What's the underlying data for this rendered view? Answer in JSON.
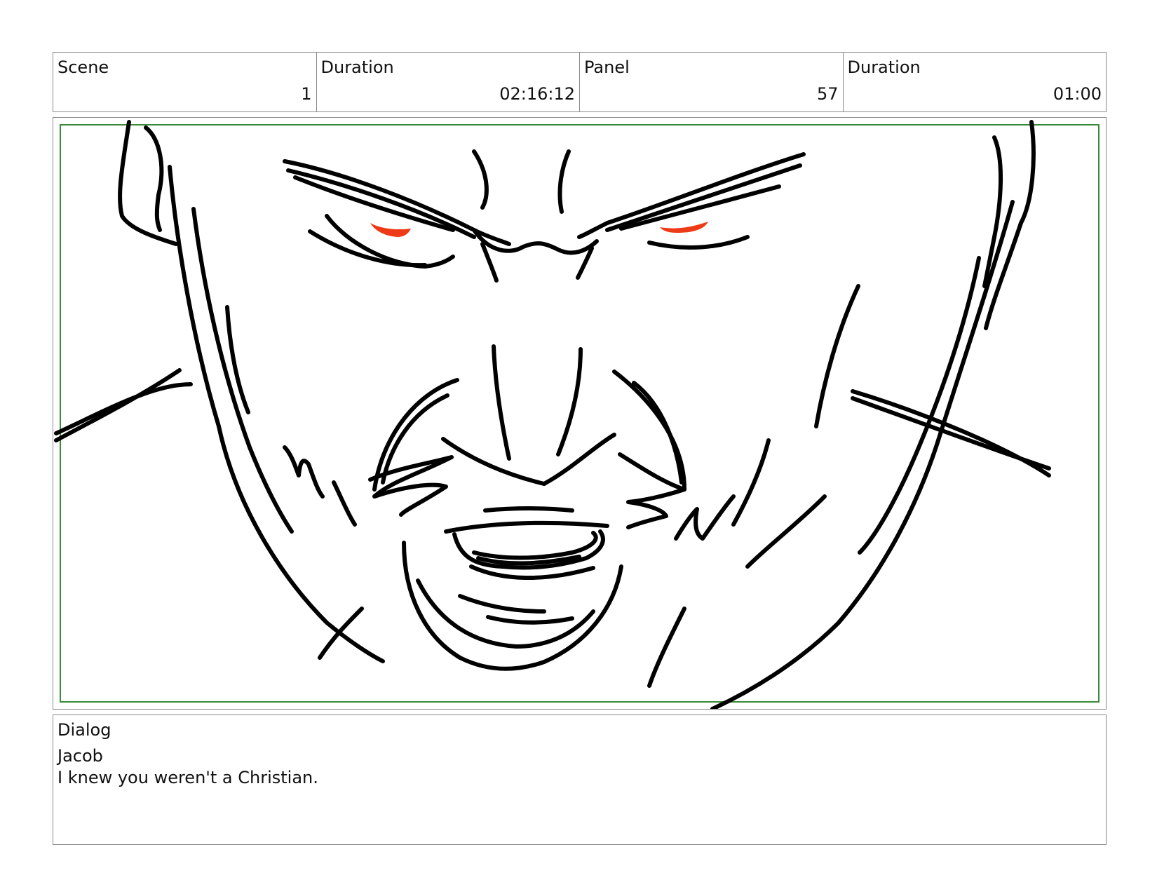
{
  "header": {
    "scene_label": "Scene",
    "scene_value": "1",
    "scene_duration_label": "Duration",
    "scene_duration_value": "02:16:12",
    "panel_label": "Panel",
    "panel_value": "57",
    "panel_duration_label": "Duration",
    "panel_duration_value": "01:00"
  },
  "panel": {
    "safe_area_color": "#3a8a3a",
    "line_color": "#000000",
    "eye_color": "#ee3a16"
  },
  "dialog": {
    "label": "Dialog",
    "speaker": "Jacob",
    "line": "I knew you weren't a Christian."
  }
}
